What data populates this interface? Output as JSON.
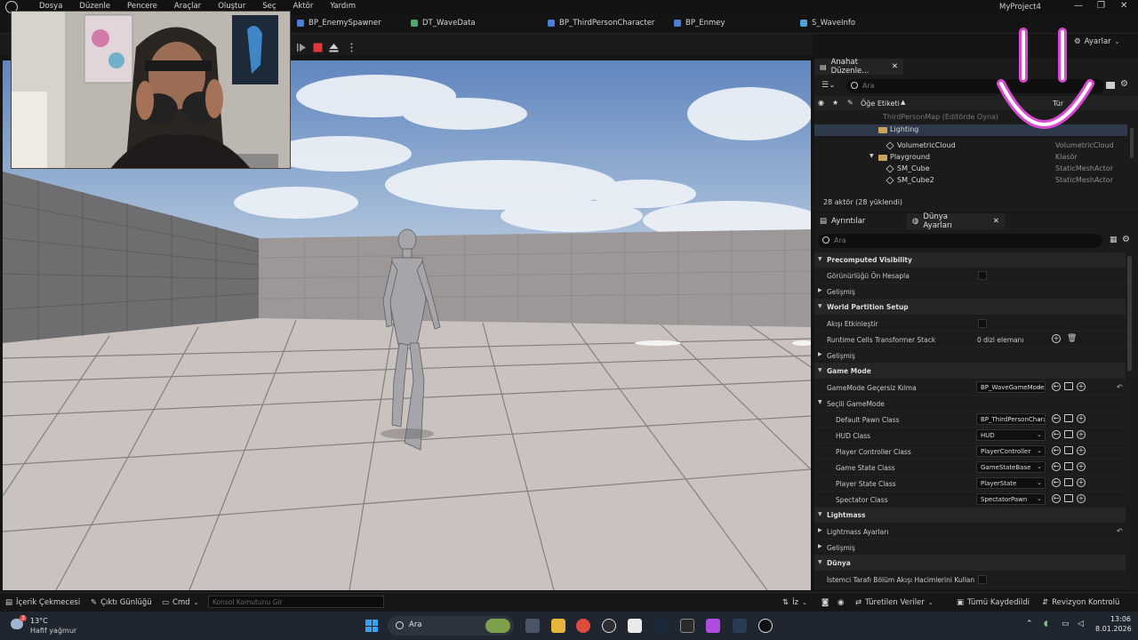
{
  "menu": [
    "Dosya",
    "Düzenle",
    "Pencere",
    "Araçlar",
    "Oluştur",
    "Seç",
    "Aktör",
    "Yardım"
  ],
  "project_name": "MyProject4",
  "window_controls": [
    "—",
    "❐",
    "✕"
  ],
  "tabs": [
    {
      "label": "BP_EnemySpawner",
      "color": "#4a7ed8"
    },
    {
      "label": "DT_WaveData",
      "color": "#4fa86b"
    },
    {
      "label": "BP_ThirdPersonCharacter",
      "color": "#4a7ed8"
    },
    {
      "label": "BP_Enmey",
      "color": "#4a7ed8"
    },
    {
      "label": "S_WaveInfo",
      "color": "#4f9fd8"
    }
  ],
  "toolbar": {
    "settings_label": "Ayarlar"
  },
  "outliner": {
    "tab_label": "Anahat Düzenle...",
    "search_placeholder": "Ara",
    "col_label": "Öğe Etiketi",
    "col_type": "Tür",
    "rows": [
      {
        "name": "ThirdPersonMap (Editörde Oyna)",
        "type": "",
        "kind": "map"
      },
      {
        "name": "Lighting",
        "type": "",
        "kind": "folder",
        "selected": true
      },
      {
        "name": "VolumetricCloud",
        "type": "VolumetricCloud",
        "kind": "actor"
      },
      {
        "name": "Playground",
        "type": "Klasör",
        "kind": "folder"
      },
      {
        "name": "SM_Cube",
        "type": "StaticMeshActor",
        "kind": "actor"
      },
      {
        "name": "SM_Cube2",
        "type": "StaticMeshActor",
        "kind": "actor"
      }
    ],
    "actor_count": "28 aktör (28 yüklendi)"
  },
  "details": {
    "tab_details": "Ayrıntılar",
    "tab_world": "Dünya Ayarları",
    "search_placeholder": "Ara",
    "sections": {
      "precomputed": "Precomputed Visibility",
      "world_partition": "World Partition Setup",
      "game_mode": "Game Mode",
      "lightmass": "Lightmass",
      "world": "Dünya"
    },
    "labels": {
      "precompute_visibility": "Görünürlüğü Ön Hesapla",
      "advanced": "Gelişmiş",
      "enable_streaming": "Akışı Etkinleştir",
      "runtime_cells": "Runtime Cells Transformer Stack",
      "runtime_cells_value": "0 dizi elemanı",
      "gamemode_override": "GameMode Geçersiz Kılma",
      "selected_gamemode": "Seçili GameMode",
      "default_pawn": "Default Pawn Class",
      "hud_class": "HUD Class",
      "player_controller": "Player Controller Class",
      "game_state": "Game State Class",
      "player_state": "Player State Class",
      "spectator": "Spectator Class",
      "lightmass_settings": "Lightmass Ayarları",
      "client_side": "İstemci Tarafı Bölüm Akışı Hacimlerini Kullan"
    },
    "values": {
      "gamemode_override": "BP_WaveGameMode",
      "default_pawn": "BP_ThirdPersonCharacter",
      "hud_class": "HUD",
      "player_controller": "PlayerController",
      "game_state": "GameStateBase",
      "player_state": "PlayerState",
      "spectator": "SpectatorPawn"
    }
  },
  "statusbar": {
    "content_drawer": "İçerik Çekmecesi",
    "output_log": "Çıktı Günlüğü",
    "cmd": "Cmd",
    "console_placeholder": "Konsol Komutunu Gir",
    "trace": "İz",
    "derived_data": "Türetilen Veriler",
    "all_saved": "Tümü Kaydedildi",
    "revision": "Revizyon Kontrolü"
  },
  "taskbar": {
    "temperature": "13°C",
    "weather": "Hafif yağmur",
    "notif_count": "3",
    "search": "Ara",
    "time": "13:06",
    "date": "8.01.2026"
  }
}
